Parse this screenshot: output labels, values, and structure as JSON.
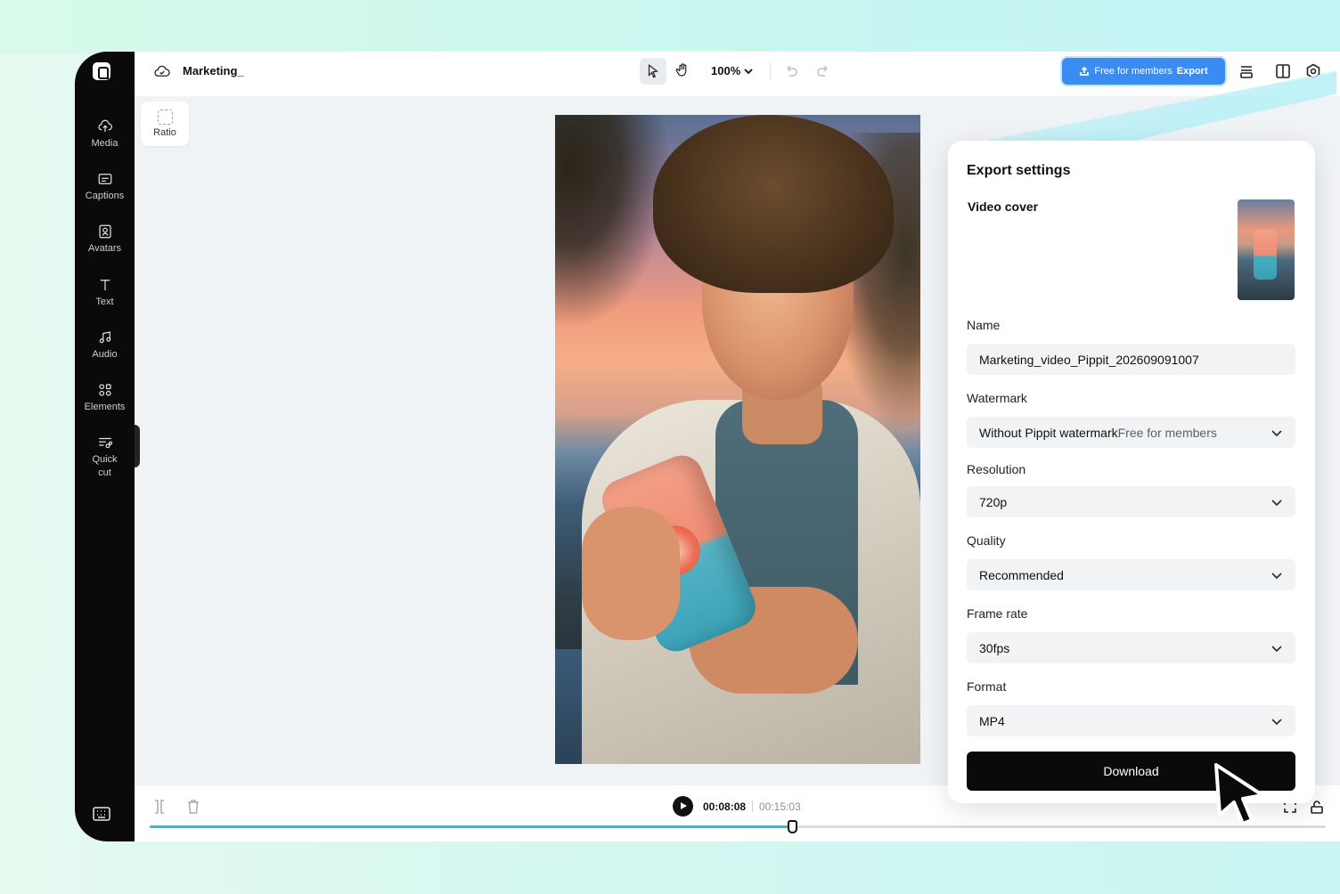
{
  "sidebar": {
    "items": [
      {
        "label": "Media",
        "icon": "cloud-upload-icon"
      },
      {
        "label": "Captions",
        "icon": "captions-icon"
      },
      {
        "label": "Avatars",
        "icon": "avatar-icon"
      },
      {
        "label": "Text",
        "icon": "text-icon"
      },
      {
        "label": "Audio",
        "icon": "music-note-icon"
      },
      {
        "label": "Elements",
        "icon": "elements-icon"
      },
      {
        "label": "Quick cut",
        "icon": "quick-cut-icon"
      }
    ]
  },
  "topbar": {
    "project_title": "Marketing_",
    "zoom": "100%",
    "export_free": "Free for members",
    "export_label": "Export"
  },
  "canvas": {
    "ratio_label": "Ratio"
  },
  "playback": {
    "current_time": "00:08:08",
    "total_time": "00:15:03",
    "progress": 0.547
  },
  "export_panel": {
    "title": "Export settings",
    "video_cover_label": "Video cover",
    "name_label": "Name",
    "name_value": "Marketing_video_Pippit_202609091007",
    "watermark_label": "Watermark",
    "watermark_value": "Without Pippit watermark",
    "watermark_note": "Free for members",
    "resolution_label": "Resolution",
    "resolution_value": "720p",
    "quality_label": "Quality",
    "quality_value": "Recommended",
    "framerate_label": "Frame rate",
    "framerate_value": "30fps",
    "format_label": "Format",
    "format_value": "MP4",
    "download_label": "Download"
  },
  "colors": {
    "accent": "#3a8cf2",
    "progress": "#1fc4d7",
    "sidebar_bg": "#0a0a0a"
  }
}
